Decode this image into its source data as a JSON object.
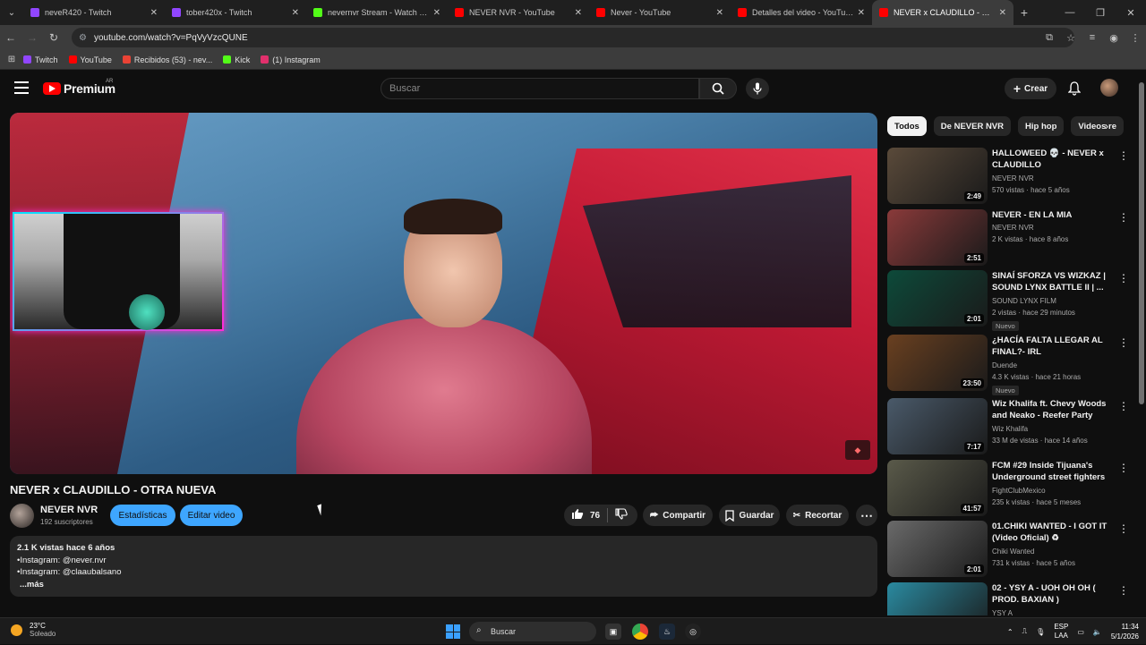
{
  "browser": {
    "tabs": [
      {
        "title": "neveR420 - Twitch",
        "favicon": "twitch-icon",
        "color": "#9146ff",
        "active": false
      },
      {
        "title": "tober420x - Twitch",
        "favicon": "twitch-icon",
        "color": "#9146ff",
        "active": false
      },
      {
        "title": "nevernvr Stream - Watch Live on Kick",
        "favicon": "kick-icon",
        "color": "#53fc18",
        "active": false
      },
      {
        "title": "NEVER NVR - YouTube",
        "favicon": "youtube-icon",
        "color": "#ff0000",
        "active": false
      },
      {
        "title": "Never - YouTube",
        "favicon": "youtube-icon",
        "color": "#ff0000",
        "active": false
      },
      {
        "title": "Detalles del video - YouTube Studio",
        "favicon": "youtube-studio-icon",
        "color": "#ff0000",
        "active": false
      },
      {
        "title": "NEVER x CLAUDILLO - OTRA NUEVA",
        "favicon": "youtube-icon",
        "color": "#ff0000",
        "active": true
      }
    ],
    "url": "youtube.com/watch?v=PqVyVzcQUNE",
    "bookmarks": [
      {
        "label": "Twitch",
        "color": "#9146ff"
      },
      {
        "label": "YouTube",
        "color": "#ff0000"
      },
      {
        "label": "Recibidos (53) - nev...",
        "color": "#ea4335"
      },
      {
        "label": "Kick",
        "color": "#53fc18"
      },
      {
        "label": "(1) Instagram",
        "color": "#e1306c"
      }
    ]
  },
  "youtube": {
    "logo_text": "Premium",
    "country": "AR",
    "search_placeholder": "Buscar",
    "create_label": "Crear",
    "video": {
      "title": "NEVER x CLAUDILLO - OTRA NUEVA",
      "channel": "NEVER NVR",
      "subscribers": "192 suscriptores",
      "stats_button": "Estadísticas",
      "edit_button": "Editar video",
      "likes": "76",
      "share": "Compartir",
      "save": "Guardar",
      "clip": "Recortar",
      "desc_meta": "2.1 K vistas  hace 6 años",
      "desc_lines": [
        "•Instagram: @never.nvr",
        "•Instagram: @claaubalsano"
      ],
      "desc_more": "...más"
    },
    "chips": [
      "Todos",
      "De NEVER NVR",
      "Hip hop",
      "Videos re"
    ],
    "related": [
      {
        "title": "HALLOWEED 💀 - NEVER x CLAUDILLO",
        "channel": "NEVER NVR",
        "meta": "570 vistas · hace 5 años",
        "duration": "2:49",
        "badge": "",
        "thumb": "#5a4a3a"
      },
      {
        "title": "NEVER - EN LA MIA",
        "channel": "NEVER NVR",
        "meta": "2 K vistas · hace 8 años",
        "duration": "2:51",
        "badge": "",
        "thumb": "#8a3a3a"
      },
      {
        "title": "SINAÍ SFORZA VS WIZKAZ | SOUND LYNX BATTLE II | ...",
        "channel": "SOUND LYNX FILM",
        "meta": "2 vistas · hace 29 minutos",
        "duration": "2:01",
        "badge": "Nuevo",
        "thumb": "#0d4a3a"
      },
      {
        "title": "¿HACÍA FALTA LLEGAR AL FINAL?- IRL",
        "channel": "Duende",
        "meta": "4.3 K vistas · hace 21 horas",
        "duration": "23:50",
        "badge": "Nuevo",
        "thumb": "#6a4020"
      },
      {
        "title": "Wiz Khalifa ft. Chevy Woods and Neako - Reefer Party",
        "channel": "Wiz Khalifa",
        "meta": "33 M de vistas · hace 14 años",
        "duration": "7:17",
        "badge": "",
        "thumb": "#4a5a6a"
      },
      {
        "title": "FCM #29  Inside Tijuana's Underground street fighters K...",
        "channel": "FightClubMexico",
        "meta": "235 k vistas · hace 5 meses",
        "duration": "41:57",
        "badge": "",
        "thumb": "#5a5a4a"
      },
      {
        "title": "01.CHIKI WANTED - I GOT IT (Video Oficial) ♻",
        "channel": "Chiki Wanted",
        "meta": "731 k vistas · hace 5 años",
        "duration": "2:01",
        "badge": "",
        "thumb": "#6a6a6a"
      },
      {
        "title": "02 - YSY A - UOH OH OH ( PROD. BAXIAN )",
        "channel": "YSY A",
        "meta": "",
        "duration": "",
        "badge": "",
        "thumb": "#2a8aa0"
      }
    ]
  },
  "taskbar": {
    "temp": "23°C",
    "weather": "Soleado",
    "search": "Buscar",
    "lang1": "ESP",
    "lang2": "LAA",
    "time": "11:34",
    "date": "5/1/2026"
  }
}
